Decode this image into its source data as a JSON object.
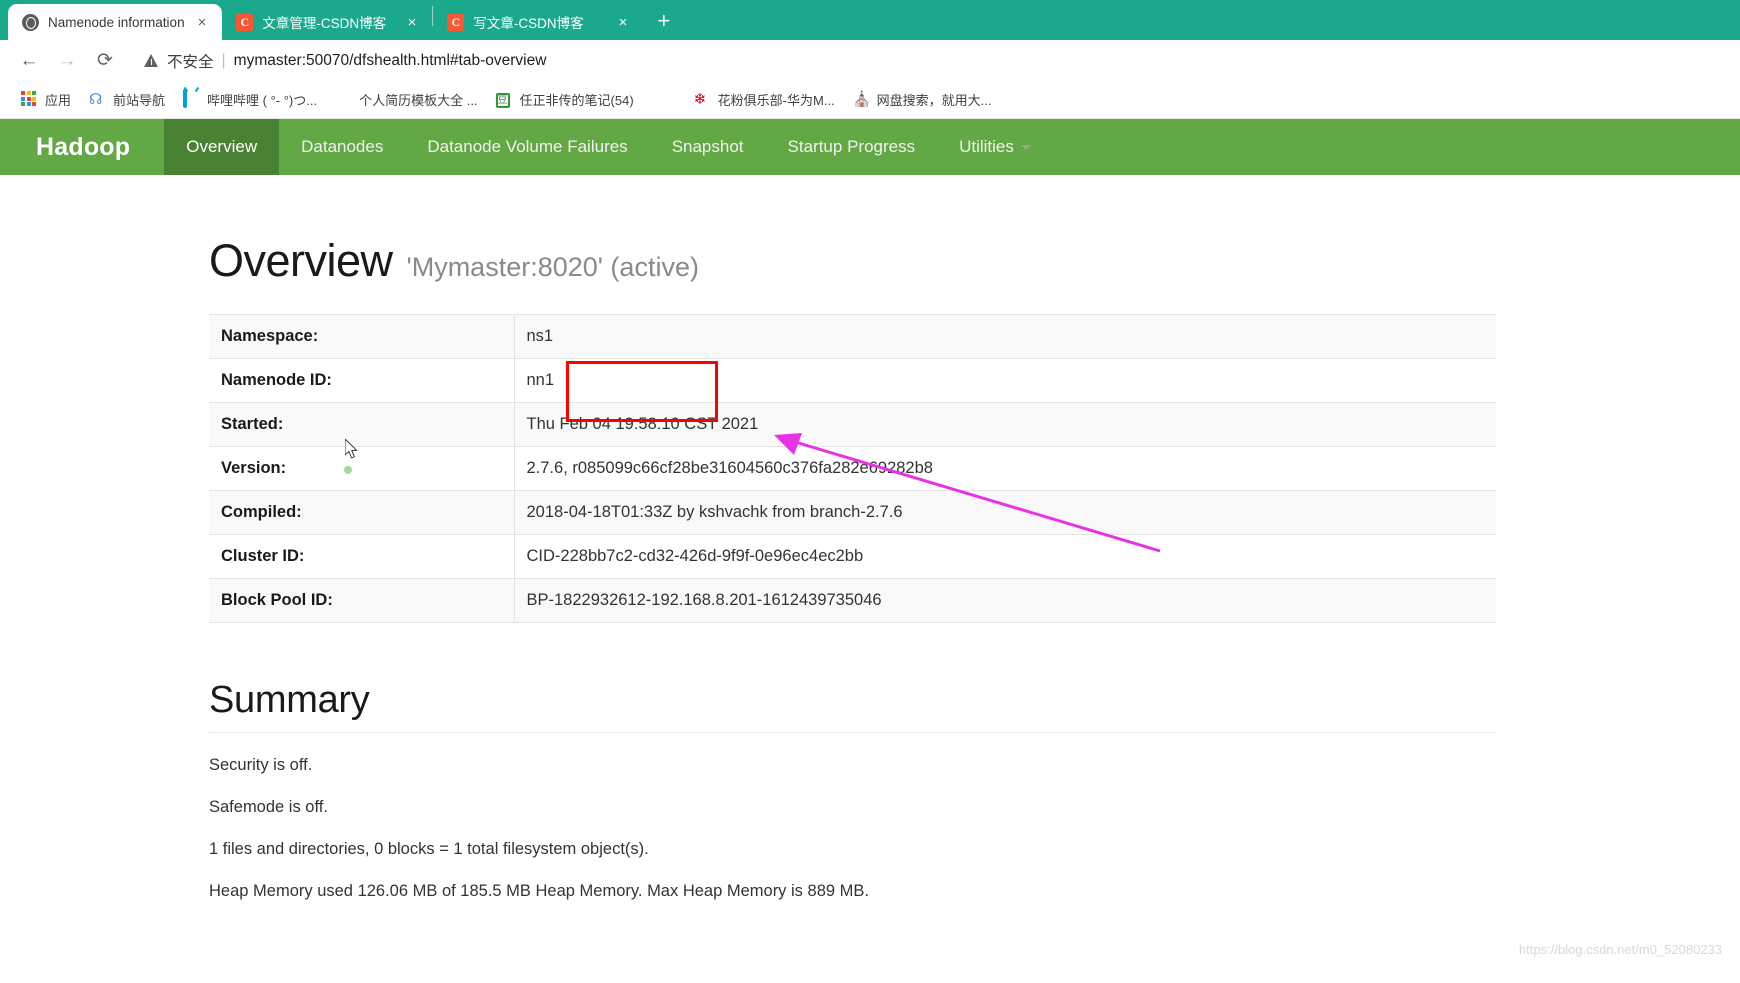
{
  "browser": {
    "tabs": [
      {
        "title": "Namenode information",
        "favicon": "globe-icon",
        "active": true,
        "close": "×"
      },
      {
        "title": "文章管理-CSDN博客",
        "favicon": "csdn-icon",
        "active": false,
        "close": "×"
      },
      {
        "title": "写文章-CSDN博客",
        "favicon": "csdn-icon",
        "active": false,
        "close": "×"
      }
    ],
    "new_tab_label": "+",
    "toolbar": {
      "back": "←",
      "forward": "→",
      "reload": "⟳",
      "security_label": "不安全",
      "separator": "|",
      "url": "mymaster:50070/dfshealth.html#tab-overview"
    },
    "bookmarks": [
      {
        "label": "应用",
        "icon": "apps-grid-icon"
      },
      {
        "label": "前站导航",
        "icon": "planet-icon"
      },
      {
        "label": "哔哩哔哩 ( °- °)つ...",
        "icon": "bilibili-icon"
      },
      {
        "label": "个人简历模板大全 ...",
        "icon": "document-icon"
      },
      {
        "label": "任正非传的笔记(54)",
        "icon": "douban-icon"
      },
      {
        "label": "",
        "icon": "globe-icon"
      },
      {
        "label": "花粉俱乐部-华为M...",
        "icon": "huawei-flower-icon"
      },
      {
        "label": "网盘搜索，就用大...",
        "icon": "orange-box-icon"
      }
    ]
  },
  "hadoop": {
    "brand": "Hadoop",
    "nav": [
      {
        "label": "Overview",
        "active": true
      },
      {
        "label": "Datanodes",
        "active": false
      },
      {
        "label": "Datanode Volume Failures",
        "active": false
      },
      {
        "label": "Snapshot",
        "active": false
      },
      {
        "label": "Startup Progress",
        "active": false
      },
      {
        "label": "Utilities",
        "active": false,
        "has_caret": true
      }
    ],
    "heading": {
      "main": "Overview",
      "sub": "'Mymaster:8020' (active)"
    },
    "properties": [
      {
        "label": "Namespace:",
        "value": "ns1"
      },
      {
        "label": "Namenode ID:",
        "value": "nn1"
      },
      {
        "label": "Started:",
        "value": "Thu Feb 04 19:58:10 CST 2021"
      },
      {
        "label": "Version:",
        "value": "2.7.6, r085099c66cf28be31604560c376fa282e69282b8"
      },
      {
        "label": "Compiled:",
        "value": "2018-04-18T01:33Z by kshvachk from branch-2.7.6"
      },
      {
        "label": "Cluster ID:",
        "value": "CID-228bb7c2-cd32-426d-9f9f-0e96ec4ec2bb"
      },
      {
        "label": "Block Pool ID:",
        "value": "BP-1822932612-192.168.8.201-1612439735046"
      }
    ],
    "summary": {
      "title": "Summary",
      "lines": [
        "Security is off.",
        "Safemode is off.",
        "1 files and directories, 0 blocks = 1 total filesystem object(s).",
        "Heap Memory used 126.06 MB of 185.5 MB Heap Memory. Max Heap Memory is 889 MB."
      ]
    }
  },
  "annotations": {
    "highlight_box_color": "#FF0000",
    "arrow_color": "#E832E8"
  },
  "watermark": "https://blog.csdn.net/m0_52080233"
}
